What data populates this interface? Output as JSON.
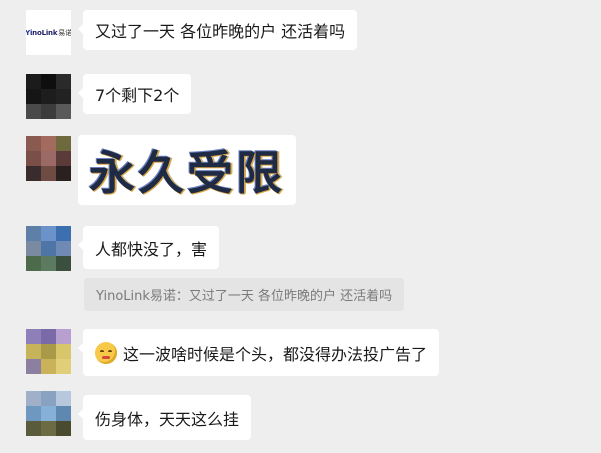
{
  "messages": [
    {
      "logo": {
        "brand_initial": "Y",
        "brand_rest": "inoLink",
        "brand_cn": "易诺"
      },
      "text": "又过了一天   各位昨晚的户  还活着吗"
    },
    {
      "text": "7个剩下2个",
      "avatar_colors": [
        "#1b1b1b",
        "#0e0e0e",
        "#2a2a2a",
        "#151515",
        "#1d1d1d",
        "#222222",
        "#4a4a4a",
        "#3c3c3c",
        "#595959"
      ]
    },
    {
      "sticker_text": "永久受限",
      "avatar_colors": [
        "#8a5a50",
        "#a36b5e",
        "#6f6a3d",
        "#7a4f47",
        "#9b6a66",
        "#5b3a3a",
        "#3a2c2c",
        "#6e4c44",
        "#2b2020"
      ]
    },
    {
      "text": "人都快没了，害",
      "quote": "YinoLink易诺：又过了一天   各位昨晚的户  还活着吗",
      "avatar_colors": [
        "#5d7fa8",
        "#6b93c9",
        "#3c6fb0",
        "#7a8aa0",
        "#4f74a6",
        "#6f8ab5",
        "#4d6a4a",
        "#5b7a60",
        "#3b4f3e"
      ]
    },
    {
      "text": "这一波啥时候是个头，都没得办法投广告了",
      "emoji": "pleading-face",
      "avatar_colors": [
        "#8f7fb8",
        "#7a6aa8",
        "#b79fd0",
        "#c6b35a",
        "#a99a4a",
        "#d8c66a",
        "#8d7fa0",
        "#c9b25a",
        "#e0cf78"
      ]
    },
    {
      "text": "伤身体，天天这么挂",
      "avatar_colors": [
        "#9fb0c8",
        "#8aa2c2",
        "#b8c8dc",
        "#6f98c0",
        "#86b0d8",
        "#5f88b0",
        "#5a5a3c",
        "#6d6b44",
        "#4a4a2e"
      ]
    }
  ]
}
